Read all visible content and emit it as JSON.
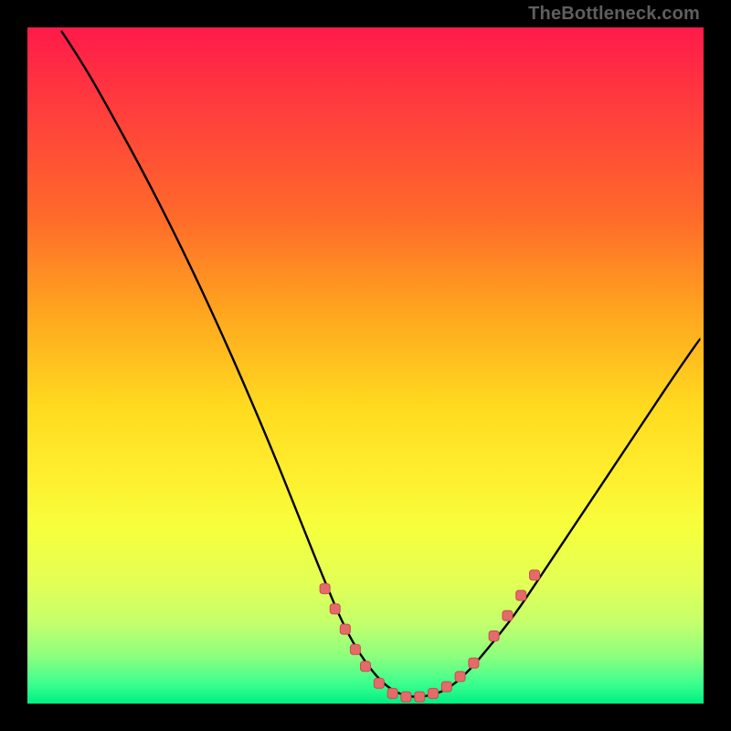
{
  "watermark": "TheBottleneck.com",
  "colors": {
    "page_bg": "#000000",
    "curve": "#000000",
    "points": "#e56a6a",
    "points_stroke": "#c54f4f"
  },
  "chart_data": {
    "type": "line",
    "title": "",
    "xlabel": "",
    "ylabel": "",
    "xlim": [
      0,
      100
    ],
    "ylim": [
      0,
      100
    ],
    "grid": false,
    "curve": [
      {
        "x": 5.0,
        "y": 99.5
      },
      {
        "x": 8.0,
        "y": 95.0
      },
      {
        "x": 12.0,
        "y": 88.0
      },
      {
        "x": 18.0,
        "y": 77.0
      },
      {
        "x": 24.0,
        "y": 65.0
      },
      {
        "x": 30.0,
        "y": 52.0
      },
      {
        "x": 36.0,
        "y": 38.0
      },
      {
        "x": 40.0,
        "y": 28.0
      },
      {
        "x": 44.0,
        "y": 18.0
      },
      {
        "x": 47.0,
        "y": 11.0
      },
      {
        "x": 50.0,
        "y": 6.0
      },
      {
        "x": 53.0,
        "y": 2.5
      },
      {
        "x": 56.0,
        "y": 1.0
      },
      {
        "x": 59.0,
        "y": 1.0
      },
      {
        "x": 62.0,
        "y": 2.0
      },
      {
        "x": 65.0,
        "y": 4.5
      },
      {
        "x": 68.0,
        "y": 8.0
      },
      {
        "x": 72.0,
        "y": 13.0
      },
      {
        "x": 76.0,
        "y": 19.0
      },
      {
        "x": 80.0,
        "y": 25.0
      },
      {
        "x": 84.0,
        "y": 31.0
      },
      {
        "x": 88.0,
        "y": 37.0
      },
      {
        "x": 92.0,
        "y": 43.0
      },
      {
        "x": 96.0,
        "y": 49.0
      },
      {
        "x": 99.5,
        "y": 54.0
      }
    ],
    "points": [
      {
        "x": 44.0,
        "y": 17.0
      },
      {
        "x": 45.5,
        "y": 14.0
      },
      {
        "x": 47.0,
        "y": 11.0
      },
      {
        "x": 48.5,
        "y": 8.0
      },
      {
        "x": 50.0,
        "y": 5.5
      },
      {
        "x": 52.0,
        "y": 3.0
      },
      {
        "x": 54.0,
        "y": 1.5
      },
      {
        "x": 56.0,
        "y": 1.0
      },
      {
        "x": 58.0,
        "y": 1.0
      },
      {
        "x": 60.0,
        "y": 1.5
      },
      {
        "x": 62.0,
        "y": 2.5
      },
      {
        "x": 64.0,
        "y": 4.0
      },
      {
        "x": 66.0,
        "y": 6.0
      },
      {
        "x": 69.0,
        "y": 10.0
      },
      {
        "x": 71.0,
        "y": 13.0
      },
      {
        "x": 73.0,
        "y": 16.0
      },
      {
        "x": 75.0,
        "y": 19.0
      }
    ]
  }
}
